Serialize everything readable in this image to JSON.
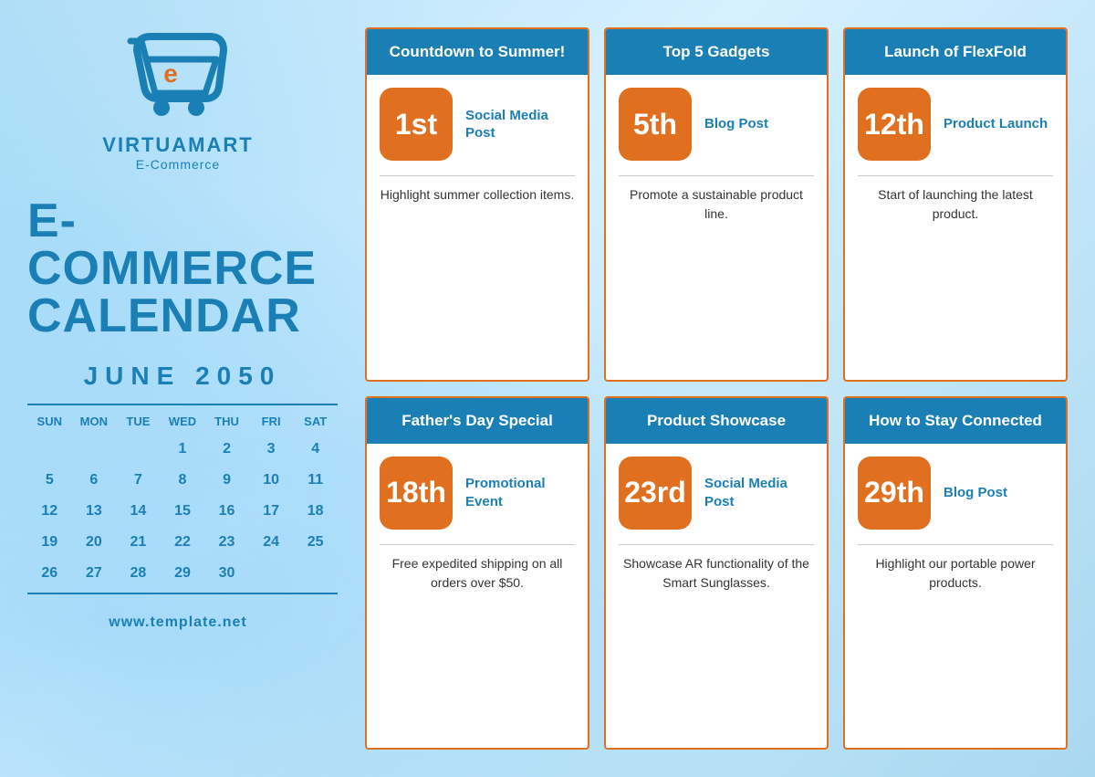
{
  "brand": {
    "name": "VIRTUAMART",
    "sub": "E-Commerce",
    "website": "www.template.net"
  },
  "title": {
    "line1": "E-COMMERCE",
    "line2": "CALENDAR"
  },
  "calendar": {
    "month_year": "JUNE 2050",
    "headers": [
      "SUN",
      "MON",
      "TUE",
      "WED",
      "THU",
      "FRI",
      "SAT"
    ],
    "weeks": [
      [
        "",
        "",
        "",
        "1",
        "2",
        "3",
        "4"
      ],
      [
        "5",
        "6",
        "7",
        "8",
        "9",
        "10",
        "11"
      ],
      [
        "12",
        "13",
        "14",
        "15",
        "16",
        "17",
        "18"
      ],
      [
        "19",
        "20",
        "21",
        "22",
        "23",
        "24",
        "25"
      ],
      [
        "26",
        "27",
        "28",
        "29",
        "30",
        "",
        ""
      ]
    ]
  },
  "events": {
    "row1": [
      {
        "title": "Countdown to Summer!",
        "date": "1st",
        "type": "Social Media Post",
        "description": "Highlight summer collection items."
      },
      {
        "title": "Top 5 Gadgets",
        "date": "5th",
        "type": "Blog Post",
        "description": "Promote a sustainable product line."
      },
      {
        "title": "Launch of FlexFold",
        "date": "12th",
        "type": "Product Launch",
        "description": "Start of launching the latest product."
      }
    ],
    "row2": [
      {
        "title": "Father's Day Special",
        "date": "18th",
        "type": "Promotional Event",
        "description": "Free expedited shipping on all orders over $50."
      },
      {
        "title": "Product Showcase",
        "date": "23rd",
        "type": "Social Media Post",
        "description": "Showcase AR functionality of the Smart Sunglasses."
      },
      {
        "title": "How to Stay Connected",
        "date": "29th",
        "type": "Blog Post",
        "description": "Highlight our portable power products."
      }
    ]
  },
  "colors": {
    "accent": "#e07020",
    "primary": "#1a7fb5",
    "white": "#ffffff"
  }
}
